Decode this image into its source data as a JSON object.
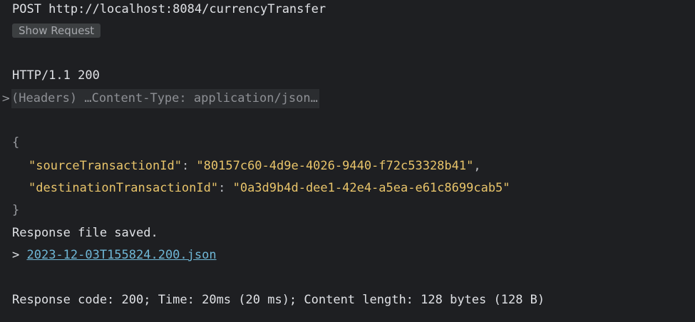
{
  "request": {
    "line": "POST http://localhost:8084/currencyTransfer",
    "show_request_label": "Show Request"
  },
  "response": {
    "status_line": "HTTP/1.1 200",
    "headers_chevron": ">",
    "headers_summary": "(Headers) …Content-Type: application/json…",
    "body": {
      "open_brace": "{",
      "close_brace": "}",
      "fields": [
        {
          "key": "\"sourceTransactionId\"",
          "separator": ": ",
          "value": "\"80157c60-4d9e-4026-9440-f72c53328b41\"",
          "trailing": ","
        },
        {
          "key": "\"destinationTransactionId\"",
          "separator": ": ",
          "value": "\"0a3d9b4d-dee1-42e4-a5ea-e61c8699cab5\"",
          "trailing": ""
        }
      ]
    },
    "saved_text": "Response file saved.",
    "file_prefix": "> ",
    "file_name": "2023-12-03T155824.200.json",
    "summary": "Response code: 200; Time: 20ms (20 ms); Content length: 128 bytes (128 B)"
  },
  "colors": {
    "background": "#1e1f22",
    "text": "#dfe1e5",
    "json_string": "#e8c46a",
    "link": "#6fb7d6",
    "button_bg": "#3c3f41",
    "headers_bg": "#2b2d30"
  },
  "icons": {
    "headers_toggle": "chevron-right-icon"
  }
}
